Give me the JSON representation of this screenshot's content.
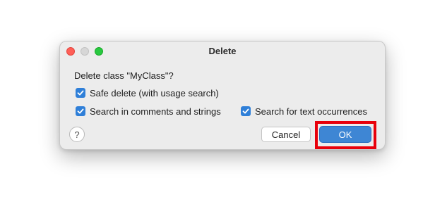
{
  "dialog": {
    "title": "Delete",
    "message": "Delete class \"MyClass\"?",
    "options": [
      {
        "label": "Safe delete (with usage search)",
        "checked": true
      },
      {
        "label": "Search in comments and strings",
        "checked": true
      },
      {
        "label": "Search for text occurrences",
        "checked": true
      }
    ],
    "help_label": "?",
    "cancel_label": "Cancel",
    "ok_label": "OK"
  },
  "colors": {
    "accent": "#2f7fd8",
    "ok_button": "#3e86d4",
    "highlight": "#e8000b"
  },
  "icons": {
    "close": "close-icon",
    "minimize": "minimize-icon",
    "maximize": "maximize-icon",
    "checkmark": "checkmark-icon",
    "help": "help-icon"
  }
}
